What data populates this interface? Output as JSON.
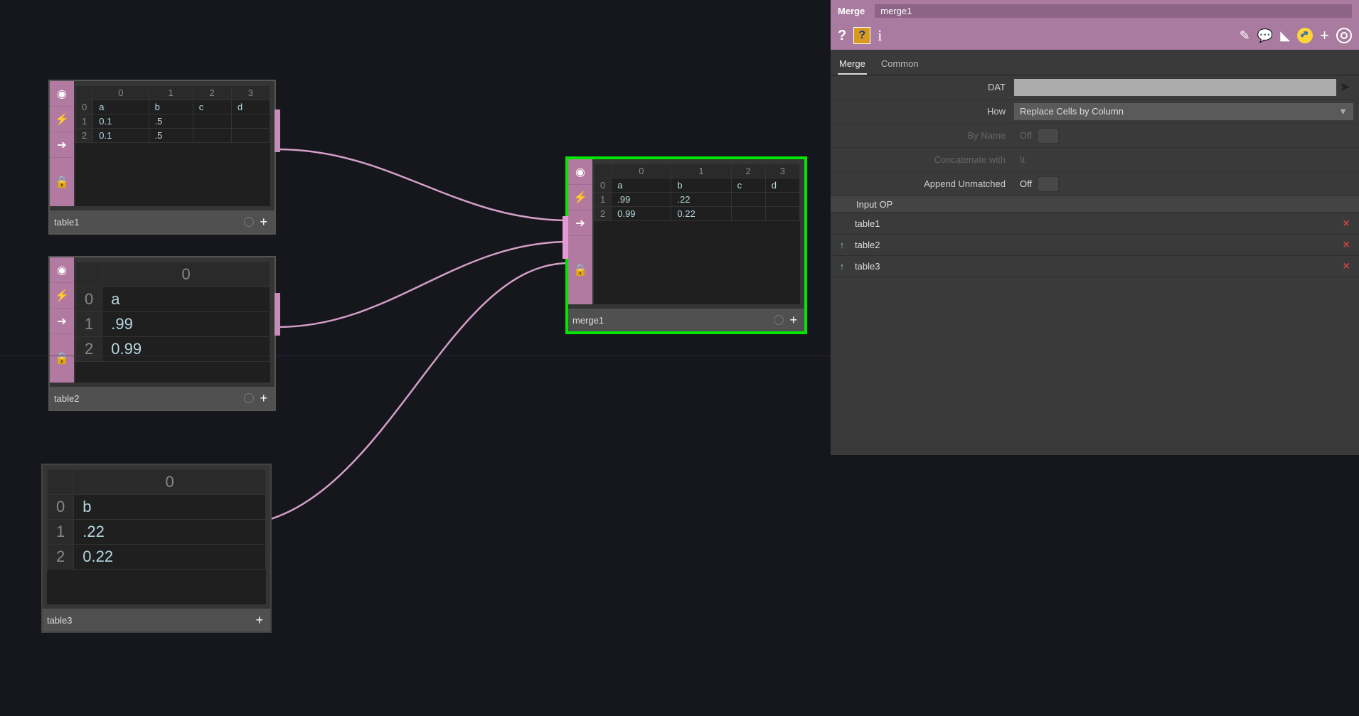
{
  "nodes": {
    "table1": {
      "name": "table1",
      "headers": [
        "0",
        "1",
        "2",
        "3"
      ],
      "rows": [
        [
          "a",
          "b",
          "c",
          "d"
        ],
        [
          "0.1",
          ".5",
          "",
          ""
        ],
        [
          "0.1",
          ".5",
          "",
          ""
        ]
      ]
    },
    "table2": {
      "name": "table2",
      "headers": [
        "0"
      ],
      "rows": [
        [
          "a"
        ],
        [
          ".99"
        ],
        [
          "0.99"
        ]
      ]
    },
    "table3": {
      "name": "table3",
      "headers": [
        "0"
      ],
      "rows": [
        [
          "b"
        ],
        [
          ".22"
        ],
        [
          "0.22"
        ]
      ]
    },
    "merge1": {
      "name": "merge1",
      "headers": [
        "0",
        "1",
        "2",
        "3"
      ],
      "rows": [
        [
          "a",
          "b",
          "c",
          "d"
        ],
        [
          ".99",
          ".22",
          "",
          ""
        ],
        [
          "0.99",
          "0.22",
          "",
          ""
        ]
      ]
    }
  },
  "params": {
    "op_type": "Merge",
    "op_name": "merge1",
    "tabs": {
      "merge": "Merge",
      "common": "Common"
    },
    "dat": {
      "label": "DAT",
      "value": ""
    },
    "how": {
      "label": "How",
      "value": "Replace Cells by Column"
    },
    "byname": {
      "label": "By Name",
      "value": "Off"
    },
    "concat": {
      "label": "Concatenate with",
      "value": "\\t"
    },
    "append": {
      "label": "Append Unmatched",
      "value": "Off"
    },
    "seq_header": "Input OP",
    "inputs": [
      "table1",
      "table2",
      "table3"
    ]
  },
  "icons": {
    "view": "◉",
    "activity": "⚡",
    "export": "➔",
    "lock": "🔒",
    "help": "?",
    "info": "i",
    "pencil": "✎",
    "comment": "💬",
    "tag": "◣",
    "plus": "+",
    "arrowup": "↑",
    "delete": "×"
  }
}
